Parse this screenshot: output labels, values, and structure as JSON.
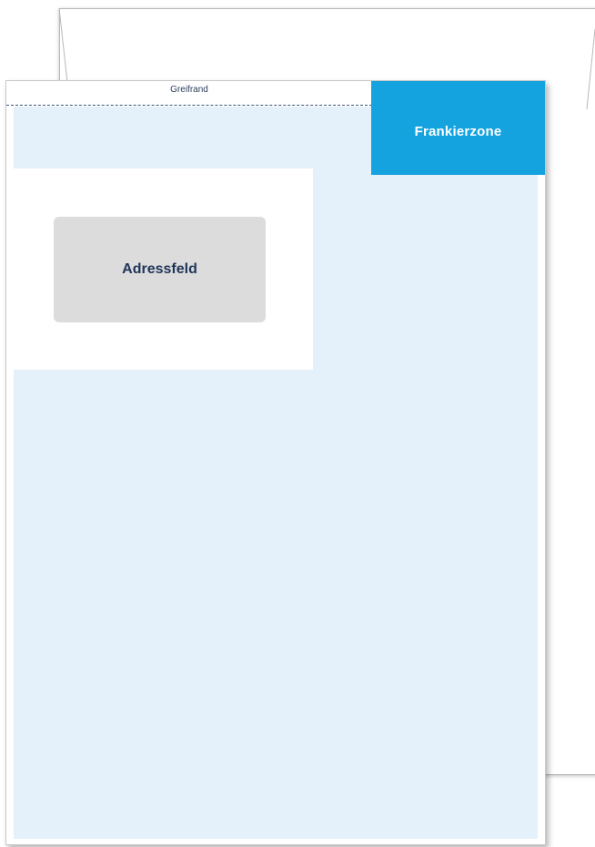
{
  "envelope": {
    "grip_margin_label": "Greifrand",
    "franking_zone_label": "Frankierzone",
    "address_field_label": "Adressfeld"
  },
  "colors": {
    "franking_zone": "#14a3df",
    "print_area": "#e4f1fb",
    "address_field": "#dcdcdc",
    "label_text": "#1f3558"
  }
}
